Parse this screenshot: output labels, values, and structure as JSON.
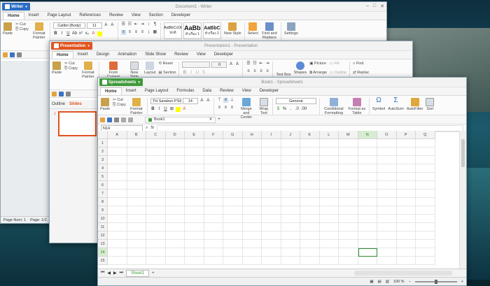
{
  "writer": {
    "app_label": "Writer",
    "title": "Document1 - Writer",
    "tabs": [
      "Home",
      "Insert",
      "Page Layout",
      "References",
      "Review",
      "View",
      "Section",
      "Developer"
    ],
    "clipboard": {
      "paste": "Paste",
      "cut": "Cut",
      "copy": "Copy",
      "format_painter": "Format Painter"
    },
    "font_name": "Calibri (Body)",
    "font_size": "11",
    "styles": [
      {
        "sample": "AaBbCcDt",
        "name": "ปกติ"
      },
      {
        "sample": "AaBb",
        "name": "หัวเรื่อง 1"
      },
      {
        "sample": "AaBbC",
        "name": "หัวเรื่อง 2"
      }
    ],
    "new_style": "New Style",
    "select": "Select",
    "find_replace": "Find and Replace",
    "settings": "Settings",
    "status": {
      "page_num": "Page Num: 1",
      "page": "Page: 1/1",
      "sec": "Se"
    }
  },
  "presentation": {
    "app_label": "Presentation",
    "title": "Presentation1 - Presentation",
    "tabs": [
      "Home",
      "Insert",
      "Design",
      "Animation",
      "Slide Show",
      "Review",
      "View",
      "Developer"
    ],
    "clipboard": {
      "paste": "Paste",
      "cut": "Cut",
      "copy": "Copy",
      "format_painter": "Format Painter"
    },
    "from_current_slide": "From Current Slide",
    "new_slide": "New Slide",
    "layout": "Layout",
    "reset": "Reset",
    "section": "Section",
    "font_size": "0",
    "text_box": "Text Box",
    "shapes": "Shapes",
    "picture": "Picture",
    "arrange": "Arrange",
    "fill": "Fill",
    "outline": "Outline",
    "find": "Find",
    "replace": "Replac",
    "panel_tabs": [
      "Outline",
      "Slides"
    ],
    "slide_number": "1"
  },
  "spreadsheets": {
    "app_label": "Spreadsheets",
    "title": "Book1 - Spreadsheets",
    "tabs": [
      "Home",
      "Insert",
      "Page Layout",
      "Formulas",
      "Data",
      "Review",
      "View",
      "Developer"
    ],
    "clipboard": {
      "paste": "Paste",
      "cut": "Cut",
      "copy": "Copy",
      "format_painter": "Format Painter"
    },
    "font_name": "TH Sarabun PSK",
    "font_size": "14",
    "merge_center": "Merge and Center",
    "wrap_text": "Wrap Text",
    "number_format": "General",
    "conditional_formatting": "Conditional Formatting",
    "format_as_table": "Format as Table",
    "symbol": "Symbol",
    "autosum": "AutoSum",
    "autofilter": "AutoFilter",
    "sort": "Sort",
    "doc_tab": "Book1",
    "name_box": "N14",
    "fx": "fx",
    "columns": [
      "A",
      "B",
      "C",
      "D",
      "E",
      "F",
      "G",
      "H",
      "I",
      "J",
      "K",
      "L",
      "M",
      "N",
      "O",
      "P",
      "Q"
    ],
    "rows": [
      "1",
      "2",
      "3",
      "4",
      "5",
      "6",
      "7",
      "8",
      "9",
      "10",
      "11",
      "12",
      "13",
      "14",
      "15"
    ],
    "selected_column": "N",
    "selected_row": "14",
    "sheet_tab": "Sheet1",
    "zoom": "100 %"
  }
}
